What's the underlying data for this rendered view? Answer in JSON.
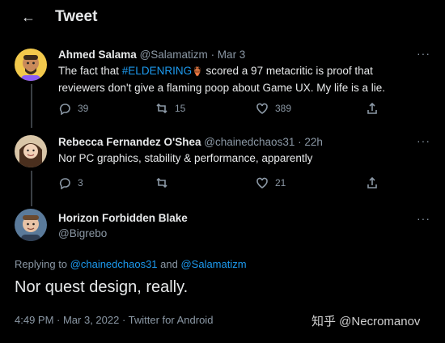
{
  "header": {
    "back_icon": "←",
    "title": "Tweet"
  },
  "tweets": [
    {
      "name": "Ahmed Salama",
      "handle": "@Salamatizm",
      "time": "· Mar 3",
      "text_pre": "The fact that ",
      "hashtag": "#ELDENRING",
      "text_post": " scored a 97 metacritic is proof that",
      "text_line2": "reviewers don't give a flaming poop about Game UX. My life is a lie.",
      "emoji": "🏺",
      "replies": "39",
      "retweets": "15",
      "likes": "389"
    },
    {
      "name": "Rebecca Fernandez O'Shea",
      "handle": "@chainedchaos31",
      "time": "· 22h",
      "text": "Nor PC graphics, stability & performance, apparently",
      "replies": "3",
      "retweets": "",
      "likes": "21"
    }
  ],
  "main": {
    "name": "Horizon Forbidden Blake",
    "handle": "@Bigrebo",
    "replying_prefix": "Replying to ",
    "reply_mention1": "@chainedchaos31",
    "reply_and": " and ",
    "reply_mention2": "@Salamatizm",
    "text": "Nor quest design, really.",
    "footer": "4:49 PM · Mar 3, 2022 · Twitter for Android"
  },
  "watermark": "知乎 @Necromanov",
  "more_icon": "···",
  "colors": {
    "background": "#000000",
    "accent": "#1d9bf0",
    "muted": "#8b98a5",
    "text": "#e7e9ea"
  }
}
